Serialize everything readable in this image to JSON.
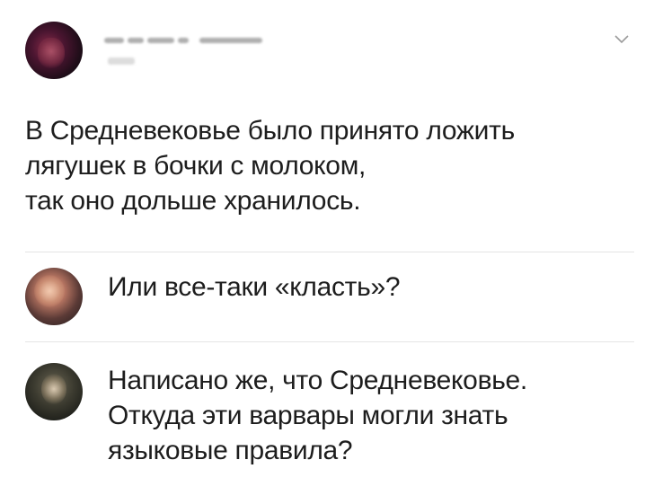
{
  "post": {
    "author_name": "",
    "text": "В Средневековье было принято ложить\nлягушек в бочки с молоком,\nтак оно дольше хранилось."
  },
  "comments": [
    {
      "text": "Или все-таки «класть»?"
    },
    {
      "text": "Написано же, что Средневековье.\nОткуда эти варвары могли знать\nязыковые правила?"
    }
  ],
  "icons": {
    "menu": "chevron-down-icon"
  },
  "colors": {
    "text": "#1d1d1d",
    "divider": "#e5e5e5",
    "background": "#ffffff"
  }
}
